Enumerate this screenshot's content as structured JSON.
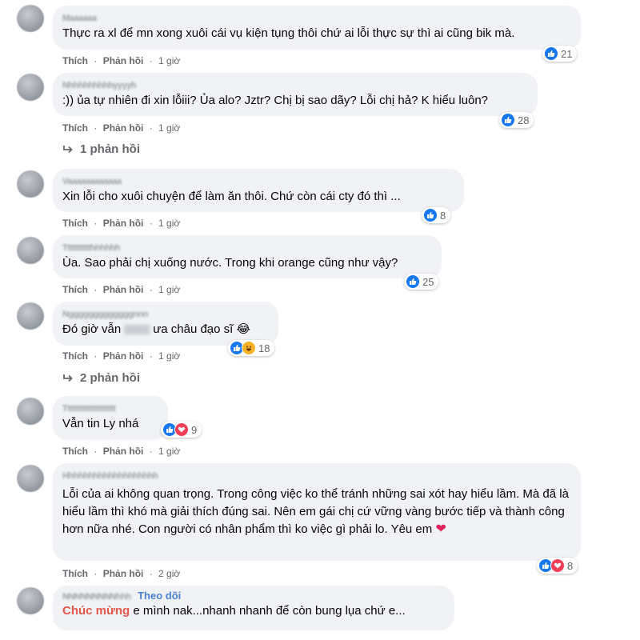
{
  "actions": {
    "like": "Thích",
    "reply": "Phản hồi",
    "sep": "·"
  },
  "comments": [
    {
      "name": "Maaaaaa",
      "text": "Thực ra xl để mn xong xuôi cái vụ kiện tụng thôi chứ ai lỗi thực sự thì ai cũng bik mà.",
      "time": "1 giờ",
      "reactions": [
        "like"
      ],
      "count": "21"
    },
    {
      "name": "Nhhhhhhhhhyyyyh",
      "text": ":)) ủa tự nhiên đi xin lỗiii? Ủa alo? Jztr? Chị bị sao dãy? Lỗi chị hả? K hiểu luôn?",
      "time": "1 giờ",
      "reactions": [
        "like"
      ],
      "count": "28",
      "replies": "1 phản hồi"
    },
    {
      "name": "Vaaaaaaaaaaaa",
      "text": "Xin lỗi cho xuôi chuyện để làm ăn thôi. Chứ còn cái cty đó thì ...",
      "time": "1 giờ",
      "reactions": [
        "like"
      ],
      "count": "8"
    },
    {
      "name": "Tttttttttthhhhhh",
      "text": "Ùa. Sao phải chị xuống nước. Trong khi orange cũng như vậy?",
      "time": "1 giờ",
      "reactions": [
        "like"
      ],
      "count": "25"
    },
    {
      "name": "Ngggggggggggggnnn",
      "text_a": "Đó giờ vẫn",
      "text_b": "ưa châu đạo sĩ 😂",
      "time": "1 giờ",
      "reactions": [
        "like",
        "haha"
      ],
      "count": "18",
      "replies": "2 phản hồi"
    },
    {
      "name": "Tttttttttttttttttttt",
      "text": "Vẫn tin Ly nhá",
      "time": "1 giờ",
      "reactions": [
        "like",
        "heart"
      ],
      "count": "9"
    },
    {
      "name": "Hhhhhhhhhhhhhhhhhhh",
      "text": "Lỗi của ai không quan trọng. Trong công việc ko thể tránh những sai xót hay hiểu lầm. Mà đã là hiểu lầm thì khó mà giải thích đúng sai. Nên em gái chị cứ vững vàng bước tiếp và thành công hơn nữa nhé. Con người có nhân phẩm thì ko việc gì phải lo. Yêu em",
      "heart": "❤",
      "time": "2 giờ",
      "reactions": [
        "like",
        "heart"
      ],
      "count": "8"
    },
    {
      "name": "NNNNNNNNNhhh",
      "follow": "Theo dõi",
      "highlight": "Chúc mừng",
      "text": "e mình nak...nhanh nhanh để còn bung lụa chứ e..."
    }
  ]
}
